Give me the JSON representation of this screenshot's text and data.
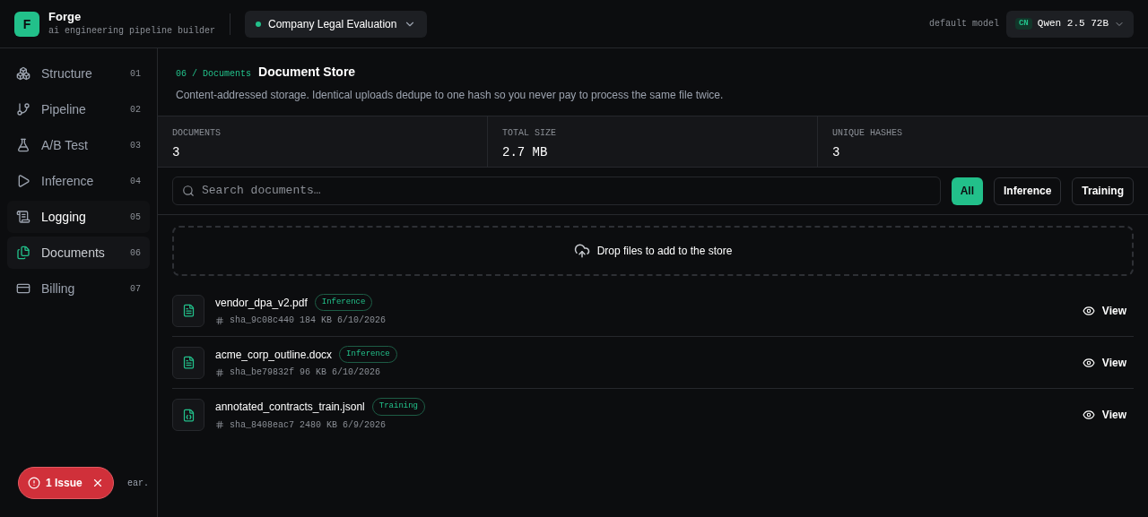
{
  "brand": {
    "letter": "F",
    "name": "Forge",
    "tagline": "ai engineering pipeline builder"
  },
  "project": {
    "name": "Company Legal Evaluation",
    "active": true
  },
  "model": {
    "label": "default model",
    "region": "CN",
    "name": "Qwen 2.5 72B"
  },
  "sidebar": {
    "items": [
      {
        "kind": "structure",
        "label": "Structure",
        "number": "01",
        "selected": false,
        "hovered": false
      },
      {
        "kind": "pipeline",
        "label": "Pipeline",
        "number": "02",
        "selected": false,
        "hovered": false
      },
      {
        "kind": "abtest",
        "label": "A/B Test",
        "number": "03",
        "selected": false,
        "hovered": false
      },
      {
        "kind": "inference",
        "label": "Inference",
        "number": "04",
        "selected": false,
        "hovered": false
      },
      {
        "kind": "logging",
        "label": "Logging",
        "number": "05",
        "selected": false,
        "hovered": true
      },
      {
        "kind": "documents",
        "label": "Documents",
        "number": "06",
        "selected": true,
        "hovered": false
      },
      {
        "kind": "billing",
        "label": "Billing",
        "number": "07",
        "selected": false,
        "hovered": false
      }
    ],
    "footer_note": "ear."
  },
  "issue_badge": {
    "label": "1 Issue"
  },
  "header": {
    "breadcrumb": "06 / Documents",
    "title": "Document Store",
    "description": "Content-addressed storage. Identical uploads dedupe to one hash so you never pay to process the same file twice."
  },
  "stats": [
    {
      "label": "DOCUMENTS",
      "value": "3"
    },
    {
      "label": "TOTAL SIZE",
      "value": "2.7 MB"
    },
    {
      "label": "UNIQUE HASHES",
      "value": "3"
    }
  ],
  "search": {
    "placeholder": "Search documents…"
  },
  "filters": [
    {
      "label": "All",
      "selected": true
    },
    {
      "label": "Inference",
      "selected": false
    },
    {
      "label": "Training",
      "selected": false
    }
  ],
  "dropzone": {
    "label": "Drop files to add to the store"
  },
  "documents": [
    {
      "kind": "text",
      "name": "vendor_dpa_v2.pdf",
      "tag": "Inference",
      "hash": "sha_9c08c440",
      "size": "184 KB",
      "date": "6/10/2026",
      "action": "View"
    },
    {
      "kind": "text",
      "name": "acme_corp_outline.docx",
      "tag": "Inference",
      "hash": "sha_be79832f",
      "size": "96 KB",
      "date": "6/10/2026",
      "action": "View"
    },
    {
      "kind": "json",
      "name": "annotated_contracts_train.jsonl",
      "tag": "Training",
      "hash": "sha_8408eac7",
      "size": "2480 KB",
      "date": "6/9/2026",
      "action": "View"
    }
  ]
}
